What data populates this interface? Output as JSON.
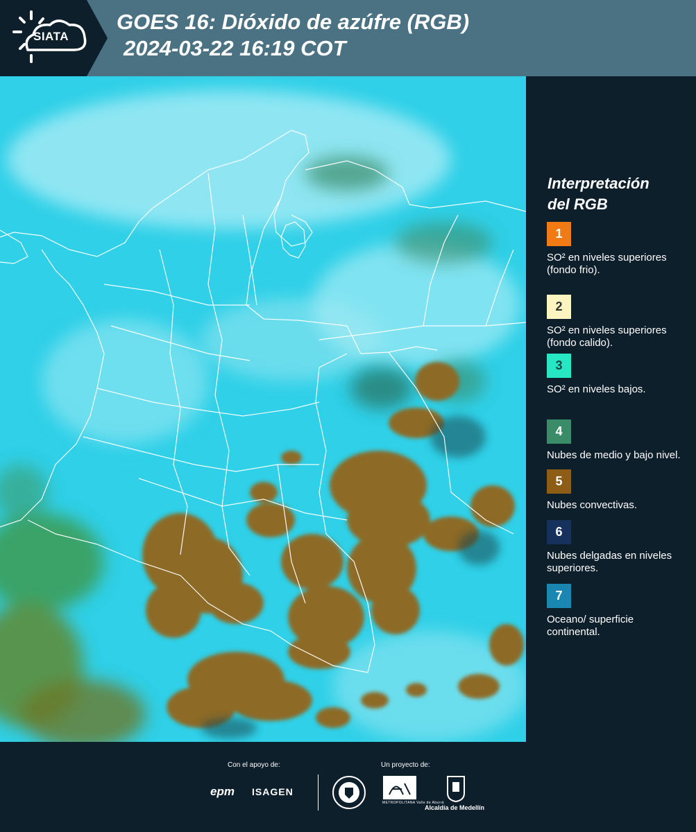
{
  "header": {
    "logo_text": "SIATA",
    "title_line1": "GOES 16: Dióxido de azúfre (RGB)",
    "title_line2": "2024-03-22 16:19 COT",
    "bg_color": "#4b7282"
  },
  "legend": {
    "title_line1": "Interpretación",
    "title_line2": "del RGB",
    "items": [
      {
        "number": "1",
        "label": "SO² en niveles superiores (fondo frio).",
        "color": "#f27a12",
        "text_color": "#ffffff"
      },
      {
        "number": "2",
        "label": "SO² en niveles superiores (fondo calido).",
        "color": "#fbf3c0",
        "text_color": "#333333"
      },
      {
        "number": "3",
        "label": "SO² en niveles bajos.",
        "color": "#26e6c4",
        "text_color": "#1b4a44"
      },
      {
        "number": "4",
        "label": "Nubes de medio y bajo nivel.",
        "color": "#3a8c68",
        "text_color": "#ffffff"
      },
      {
        "number": "5",
        "label": "Nubes convectivas.",
        "color": "#8d5d16",
        "text_color": "#ffffff"
      },
      {
        "number": "6",
        "label": "Nubes delgadas en niveles superiores.",
        "color": "#15315c",
        "text_color": "#ffffff"
      },
      {
        "number": "7",
        "label": "Oceano/ superficie continental.",
        "color": "#1a87b3",
        "text_color": "#ffffff"
      }
    ]
  },
  "footer": {
    "support_caption": "Con el apoyo de:",
    "project_caption": "Un proyecto de:",
    "sponsors": [
      "epm",
      "ISAGEN"
    ],
    "project_logos": [
      "Área Metropolitana Valle de Aburrá",
      "Alcaldía de Medellín"
    ],
    "metro_caption": "METROPOLITANA Valle de Aburrá",
    "alcaldia_label": "Alcaldía de Medellín"
  },
  "map": {
    "ocean_color": "#2fd0e8",
    "cloud_color": "#8d6a25",
    "boundary_color": "#ffffff"
  }
}
